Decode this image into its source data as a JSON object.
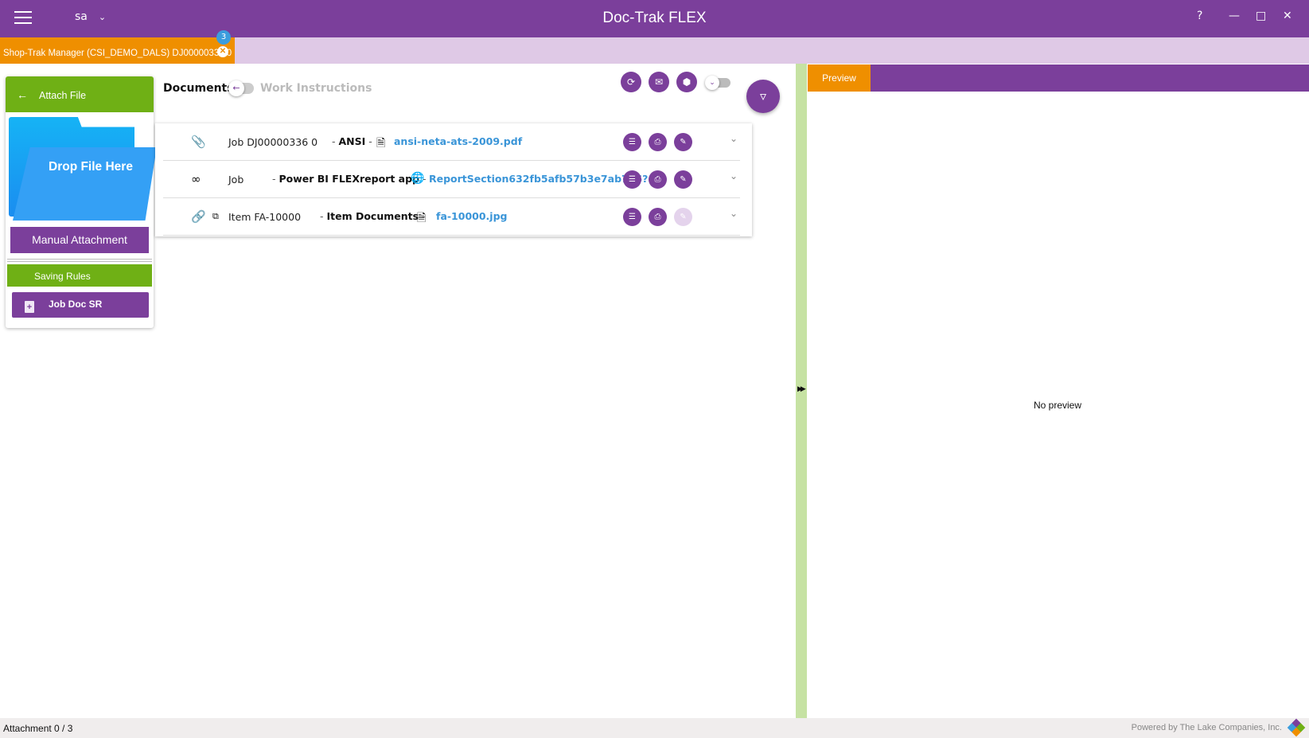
{
  "titlebar": {
    "title": "Doc-Trak FLEX",
    "user": "sa",
    "help": "?",
    "minimize": "—",
    "maximize": "□",
    "close": "✕"
  },
  "tabs": [
    {
      "label": "Shop-Trak Manager (CSI_DEMO_DALS) DJ00000336 0",
      "badge": "3",
      "active": true
    }
  ],
  "left_panel": {
    "attach_header": "Attach File",
    "drop_label": "Drop File Here",
    "manual_button": "Manual Attachment",
    "saving_rules_header": "Saving Rules",
    "rules": [
      {
        "label": "Job Doc SR"
      }
    ]
  },
  "toolbar": {
    "documents_label": "Documents",
    "work_instructions_label": "Work Instructions",
    "icons": [
      "refresh-icon",
      "email-icon",
      "package-icon",
      "filter-icon"
    ]
  },
  "documents": [
    {
      "link_icon": "paperclip-icon",
      "context": "Job DJ00000336 0",
      "group": "ANSI",
      "file_icon": "file-icon",
      "file": "ansi-neta-ats-2009.pdf",
      "edit_enabled": true
    },
    {
      "link_icon": "infinity-icon",
      "context": "Job",
      "group": "Power BI FLEXreport app",
      "file_icon": "globe-icon",
      "file": "ReportSection632fb5afb57b3e7ab776?",
      "edit_enabled": true
    },
    {
      "link_icon": "link-icon",
      "context": "Item FA-10000",
      "group": "Item Documents",
      "file_icon": "file-icon",
      "file": "fa-10000.jpg",
      "edit_enabled": false
    }
  ],
  "preview": {
    "tab_label": "Preview",
    "empty_text": "No preview"
  },
  "status": {
    "left": "Attachment 0 / 3",
    "right": "Powered by The Lake Companies, Inc."
  },
  "colors": {
    "primary": "#7b3f9b",
    "accent": "#ef8f00",
    "green": "#6fb015",
    "link": "#3a95d8"
  }
}
